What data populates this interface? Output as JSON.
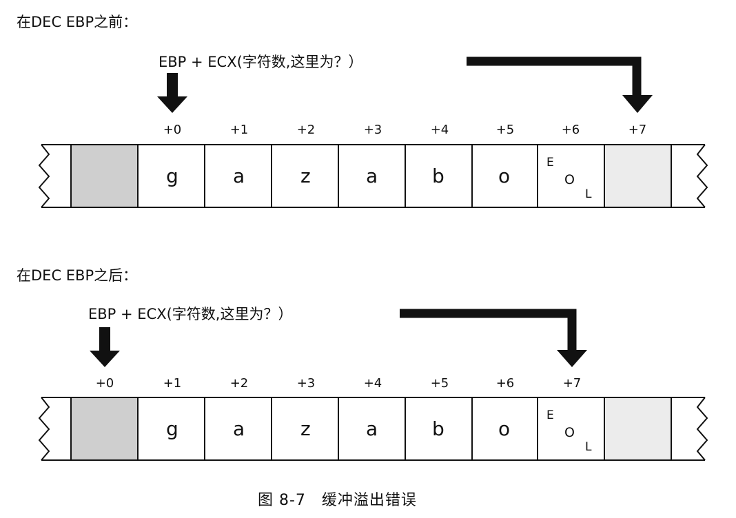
{
  "figure": {
    "caption": "图 8-7　缓冲溢出错误"
  },
  "panels": [
    {
      "title": "在DEC EBP之前：",
      "pointer_label": "EBP + ECX(字符数,这里为？）",
      "indices": [
        "+0",
        "+1",
        "+2",
        "+3",
        "+4",
        "+5",
        "+6",
        "+7"
      ],
      "cells": [
        "g",
        "a",
        "z",
        "a",
        "b",
        "o"
      ],
      "eol": {
        "e": "E",
        "o": "O",
        "l": "L"
      }
    },
    {
      "title": "在DEC EBP之后：",
      "pointer_label": "EBP + ECX(字符数,这里为？）",
      "indices": [
        "+0",
        "+1",
        "+2",
        "+3",
        "+4",
        "+5",
        "+6",
        "+7"
      ],
      "cells": [
        "g",
        "a",
        "z",
        "a",
        "b",
        "o"
      ],
      "eol": {
        "e": "E",
        "o": "O",
        "l": "L"
      }
    }
  ]
}
